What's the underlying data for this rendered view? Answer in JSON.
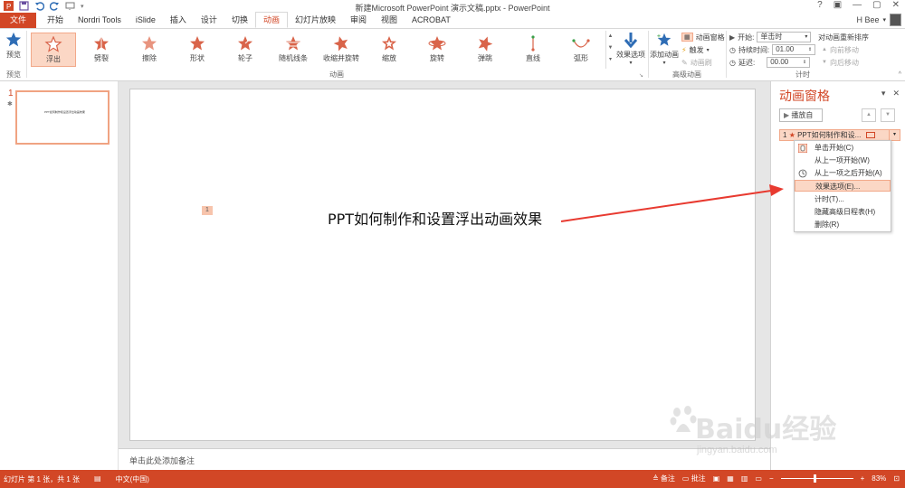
{
  "window": {
    "title": "新建Microsoft PowerPoint 演示文稿.pptx - PowerPoint",
    "controls": [
      "?",
      "▣",
      "—",
      "▢",
      "✕"
    ]
  },
  "tabs": [
    "文件",
    "开始",
    "Nordri Tools",
    "iSlide",
    "插入",
    "设计",
    "切换",
    "动画",
    "幻灯片放映",
    "审阅",
    "视图",
    "ACROBAT"
  ],
  "active_tab": "动画",
  "user": {
    "name": "H​ Bee"
  },
  "ribbon": {
    "preview": {
      "label": "预览",
      "group": "预览"
    },
    "animations": [
      "浮出",
      "劈裂",
      "擦除",
      "形状",
      "轮子",
      "随机线条",
      "收缩并旋转",
      "缩放",
      "旋转",
      "弹跳",
      "直线",
      "弧形"
    ],
    "selected_animation": "浮出",
    "effect_options": "效果选项",
    "group_animation": "动画",
    "add_animation": "添加动画",
    "animation_pane_btn": "动画窗格",
    "trigger": "触发",
    "animation_painter": "动画刷",
    "group_advanced": "高级动画",
    "start_label": "开始:",
    "start_value": "单击时",
    "duration_label": "持续时间:",
    "duration_value": "01.00",
    "delay_label": "延迟:",
    "delay_value": "00.00",
    "reorder_title": "对动画重新排序",
    "move_earlier": "向前移动",
    "move_later": "向后移动",
    "group_timing": "计时"
  },
  "slides_pane": {
    "slide_number": "1",
    "thumb_text": "PPT如何制作和设置浮出动画效果"
  },
  "slide": {
    "anim_tag": "1",
    "title": "PPT如何制作和设置浮出动画效果"
  },
  "notes": {
    "placeholder": "单击此处添加备注"
  },
  "animation_pane": {
    "title": "动画窗格",
    "play_button": "播放自",
    "item_index": "1",
    "item_label": "PPT如何制作和设..."
  },
  "context_menu": {
    "items": [
      "单击开始(C)",
      "从上一项开始(W)",
      "从上一项之后开始(A)",
      "效果选项(E)...",
      "计时(T)...",
      "隐藏高级日程表(H)",
      "删除(R)"
    ],
    "highlighted_index": 3
  },
  "status_bar": {
    "slide_info": "幻灯片 第 1 张，共 1 张",
    "language": "中文(中国)",
    "notes_btn": "备注",
    "comments_btn": "批注",
    "zoom": "83%"
  },
  "watermark": {
    "brand": "Baidu经验",
    "url": "jingyan.baidu.com"
  },
  "colors": {
    "accent": "#d24726",
    "selection": "#fbd7c5",
    "arrow": "#e83a30"
  }
}
